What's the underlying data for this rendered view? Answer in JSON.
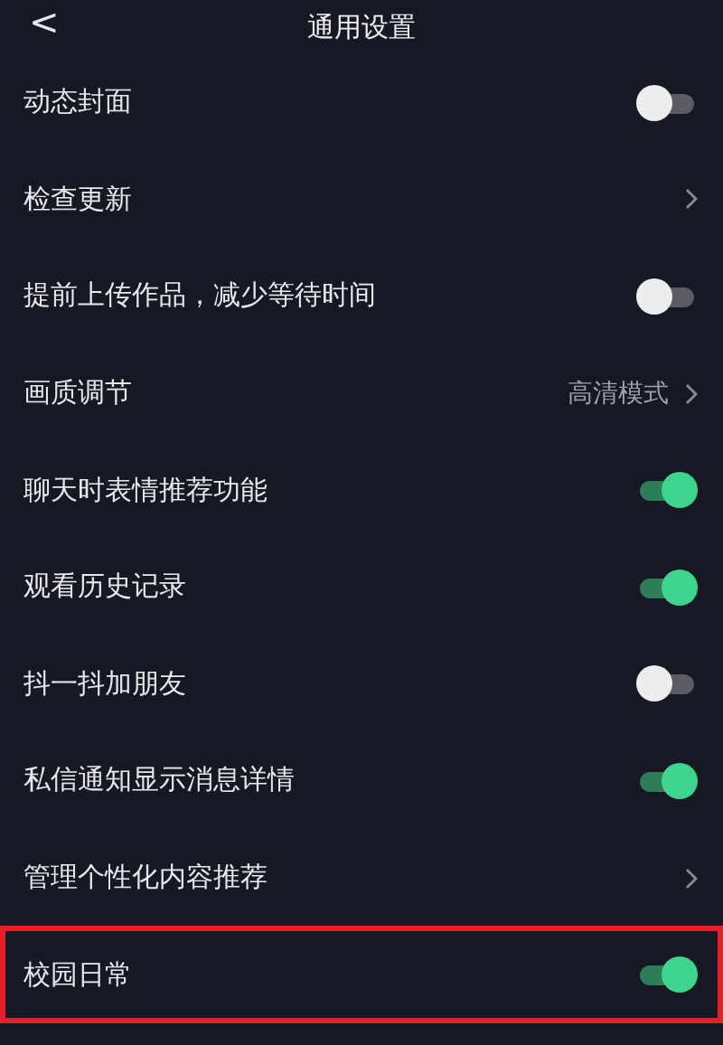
{
  "header": {
    "back": "<",
    "title": "通用设置"
  },
  "rows": [
    {
      "label": "动态封面",
      "kind": "toggle",
      "on": false,
      "highlighted": false
    },
    {
      "label": "检查更新",
      "kind": "link",
      "highlighted": false
    },
    {
      "label": "提前上传作品，减少等待时间",
      "kind": "toggle",
      "on": false,
      "highlighted": false
    },
    {
      "label": "画质调节",
      "kind": "link",
      "value": "高清模式",
      "highlighted": false
    },
    {
      "label": "聊天时表情推荐功能",
      "kind": "toggle",
      "on": true,
      "highlighted": false
    },
    {
      "label": "观看历史记录",
      "kind": "toggle",
      "on": true,
      "highlighted": false
    },
    {
      "label": "抖一抖加朋友",
      "kind": "toggle",
      "on": false,
      "highlighted": false
    },
    {
      "label": "私信通知显示消息详情",
      "kind": "toggle",
      "on": true,
      "highlighted": false
    },
    {
      "label": "管理个性化内容推荐",
      "kind": "link",
      "highlighted": false
    },
    {
      "label": "校园日常",
      "kind": "toggle",
      "on": true,
      "highlighted": true
    }
  ]
}
